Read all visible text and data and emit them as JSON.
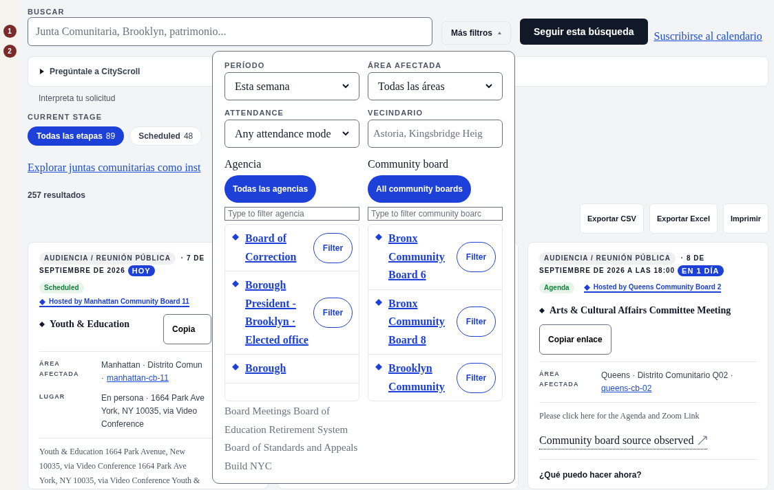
{
  "sidebar_markers": [
    "1",
    "2"
  ],
  "search": {
    "label": "BUSCAR",
    "placeholder": "Junta Comunitaria, Brooklyn, patrimonio..."
  },
  "filters_button": {
    "label": "Más filtros",
    "expanded": true
  },
  "follow_button": "Seguir esta búsqueda",
  "calendar_link": "Suscribirse al calendario",
  "assistant": {
    "label": "Pregúntale a CityScroll",
    "expanded": false,
    "hint": "Interpreta tu solicitud"
  },
  "stage": {
    "label": "CURRENT STAGE",
    "chips": [
      {
        "label": "Todas las etapas",
        "count": "89",
        "selected": true
      },
      {
        "label": "Scheduled",
        "count": "48",
        "selected": false
      }
    ]
  },
  "explore_link": "Explorar juntas comunitarias como inst",
  "result_count": "257 resultados",
  "actions": [
    "Exportar CSV",
    "Exportar Excel",
    "Imprimir"
  ],
  "filters_panel": {
    "selects": [
      {
        "kind": "select",
        "label": "PERÍODO",
        "value": "Esta semana"
      },
      {
        "kind": "select",
        "label": "ÁREA AFECTADA",
        "value": "Todas las áreas"
      },
      {
        "kind": "select",
        "label": "ATTENDANCE",
        "value": "Any attendance mode"
      },
      {
        "kind": "text",
        "label": "VECINDARIO",
        "placeholder": "Astoria, Kingsbridge Heig"
      }
    ],
    "groups": [
      {
        "title": "Agencia",
        "all_button": "Todas las agencias",
        "filter_placeholder": "Type to filter agencia",
        "items": [
          {
            "name": "Board of Correction",
            "action": "Filter"
          },
          {
            "name": "Borough President - Brooklyn · Elected office",
            "action": "Filter"
          },
          {
            "name": "Borough"
          }
        ],
        "overflow_text": "Board Meetings Board of Education Retirement System Board of Standards and Appeals Build NYC"
      },
      {
        "title": "Community board",
        "all_button": "All community boards",
        "filter_placeholder": "Type to filter community boarc",
        "items": [
          {
            "name": "Bronx Community Board 6",
            "action": "Filter"
          },
          {
            "name": "Bronx Community Board 8",
            "action": "Filter"
          },
          {
            "name": "Brooklyn Community",
            "action": "Filter"
          }
        ]
      }
    ]
  },
  "cards": [
    {
      "kind": "event",
      "type_tag": "AUDIENCIA / REUNIÓN PÚBLICA",
      "date_lines": [
        "· 7 DE",
        "SEPTIEMBRE DE 2026"
      ],
      "badge": "HOY",
      "status": "Scheduled",
      "host": "Hosted by Manhattan Community Board 11",
      "title": "Youth & Education",
      "copy_button": "Copia",
      "details": [
        {
          "label": "ÁREA AFECTADA",
          "lines": [
            "Manhattan · Distrito Comun"
          ],
          "link_prefix": "·",
          "link": "manhattan-cb-11"
        },
        {
          "label": "LUGAR",
          "lines": [
            "En persona · 1664 Park Ave",
            "York, NY 10035, via Video",
            "Conference"
          ]
        }
      ],
      "description_lines": [
        "Youth & Education 1664 Park Avenue, New",
        "10035, via Video Conference 1664 Park Ave",
        "York, NY 10035, via Video Conference Youth &"
      ]
    },
    {
      "kind": "covered"
    },
    {
      "kind": "event",
      "type_tag": "AUDIENCIA / REUNIÓN PÚBLICA",
      "date_lines": [
        "· 8 DE",
        "SEPTIEMBRE DE 2026 A LAS 18:00"
      ],
      "badge": "EN 1 DÍA",
      "status": "Agenda",
      "host": "Hosted by Queens Community Board 2",
      "title": "Arts & Cultural Affairs Committee Meeting",
      "copy_button": "Copiar enlace",
      "details": [
        {
          "label": "ÁREA AFECTADA",
          "lines": [
            "Queens · Distrito Comunitario Q02 ·"
          ],
          "link": "queens-cb-02"
        }
      ],
      "description_lines": [
        "Please click here for the Agenda and Zoom Link"
      ],
      "source_link": "Community board source observed",
      "next_heading": "¿Qué puedo hacer ahora?"
    }
  ]
}
